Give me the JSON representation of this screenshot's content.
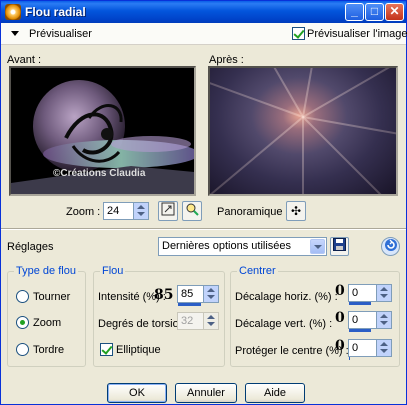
{
  "window": {
    "title": "Flou radial"
  },
  "titlebar_buttons": {
    "minimize": "_",
    "maximize": "□",
    "close": "✕"
  },
  "preview_bar": {
    "label": "Prévisualiser",
    "checkbox_label": "Prévisualiser l'image",
    "checkbox_checked": true
  },
  "before": {
    "label": "Avant :",
    "watermark": "©Créations Claudia"
  },
  "after": {
    "label": "Après :"
  },
  "zoom": {
    "label": "Zoom :",
    "value": "24"
  },
  "panoramique": {
    "label": "Panoramique :"
  },
  "reglages": {
    "label": "Réglages",
    "selected": "Dernières options utilisées"
  },
  "type_de_flou": {
    "title": "Type de flou",
    "options": [
      "Tourner",
      "Zoom",
      "Tordre"
    ],
    "selected": "Zoom"
  },
  "flou": {
    "title": "Flou",
    "intensity_label": "Intensité (%) :",
    "intensity_value": "85",
    "torsion_label": "Degrés de torsion :",
    "torsion_value": "32",
    "elliptique_label": "Elliptique",
    "elliptique_checked": true
  },
  "centrer": {
    "title": "Centrer",
    "horiz_label": "Décalage horiz. (%) :",
    "horiz_value": "0",
    "vert_label": "Décalage vert. (%) :",
    "vert_value": "0",
    "protect_label": "Protéger le centre (%) :",
    "protect_value": "0",
    "big_value": "0"
  },
  "buttons": {
    "ok": "OK",
    "cancel": "Annuler",
    "help": "Aide"
  }
}
